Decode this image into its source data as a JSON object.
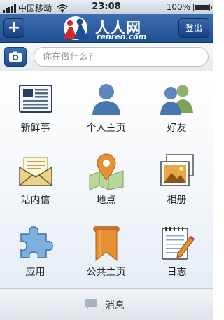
{
  "status_bar": {
    "carrier": "中国移动",
    "time": "23:08",
    "battery_text": "100%",
    "battery_level": 1.0,
    "icons": [
      "signal-icon",
      "wifi-icon",
      "battery-icon"
    ]
  },
  "nav": {
    "add_label": "+",
    "logo_text": "人人网",
    "logo_domain": "renren.com",
    "logout_label": "登出"
  },
  "search": {
    "placeholder": "你在做什么?"
  },
  "grid": [
    {
      "label": "新鲜事",
      "icon": "newsfeed-icon"
    },
    {
      "label": "个人主页",
      "icon": "profile-icon"
    },
    {
      "label": "好友",
      "icon": "friends-icon"
    },
    {
      "label": "站内信",
      "icon": "mail-icon"
    },
    {
      "label": "地点",
      "icon": "map-pin-icon"
    },
    {
      "label": "相册",
      "icon": "photo-album-icon"
    },
    {
      "label": "应用",
      "icon": "puzzle-icon"
    },
    {
      "label": "公共主页",
      "icon": "public-page-ribbon-icon"
    },
    {
      "label": "日志",
      "icon": "notepad-icon"
    }
  ],
  "bottom": {
    "label": "消息",
    "icon": "chat-bubble-icon"
  },
  "colors": {
    "nav_blue": "#2a5b9f",
    "accent_orange": "#e59032"
  }
}
